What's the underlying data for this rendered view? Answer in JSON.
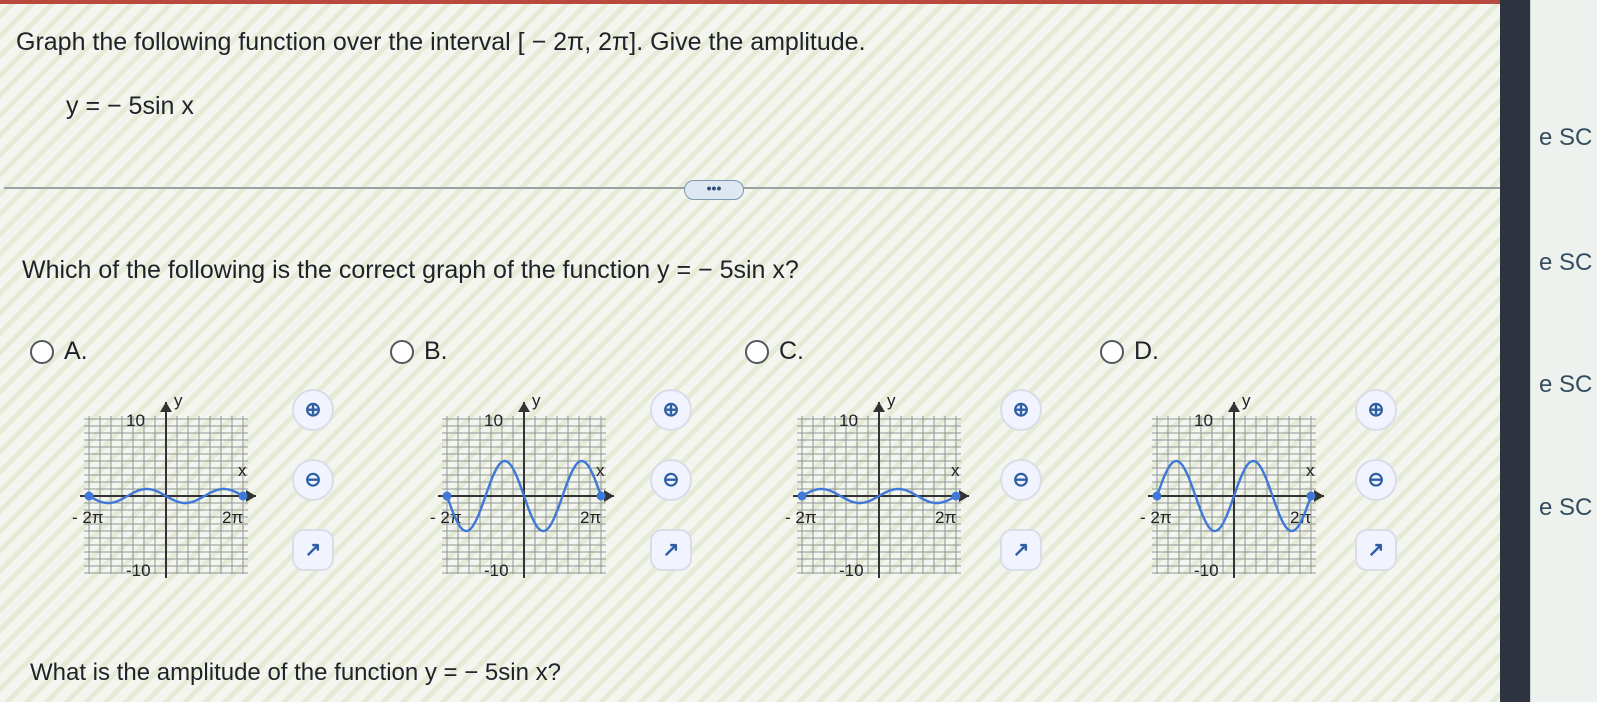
{
  "question": "Graph the following function over the interval [ − 2π, 2π]. Give the amplitude.",
  "formula": "y = − 5sin x",
  "more_button": "•••",
  "subquestion": "Which of the following is the correct graph of the function y = − 5sin x?",
  "options": [
    {
      "id": "A",
      "label": "A.",
      "amplitude": 1,
      "sign": -1
    },
    {
      "id": "B",
      "label": "B.",
      "amplitude": 5,
      "sign": -1
    },
    {
      "id": "C",
      "label": "C.",
      "amplitude": 1,
      "sign": 1
    },
    {
      "id": "D",
      "label": "D.",
      "amplitude": 5,
      "sign": 1
    }
  ],
  "axis": {
    "y_label": "y",
    "x_label": "x",
    "y_top": "10",
    "y_bottom": "-10",
    "x_left": "- 2π",
    "x_right": "2π"
  },
  "bottom_question": "What is the amplitude of the function y = − 5sin x?",
  "side_items": [
    "e SC",
    "e SC",
    "e SC",
    "e SC"
  ],
  "colors": {
    "curve": "#3f78d6",
    "grid": "#8d9696",
    "accent": "#2e5ea3"
  },
  "icons": {
    "zoom_in": "zoom-in-icon",
    "zoom_out": "zoom-out-icon",
    "popout": "popout-icon"
  }
}
